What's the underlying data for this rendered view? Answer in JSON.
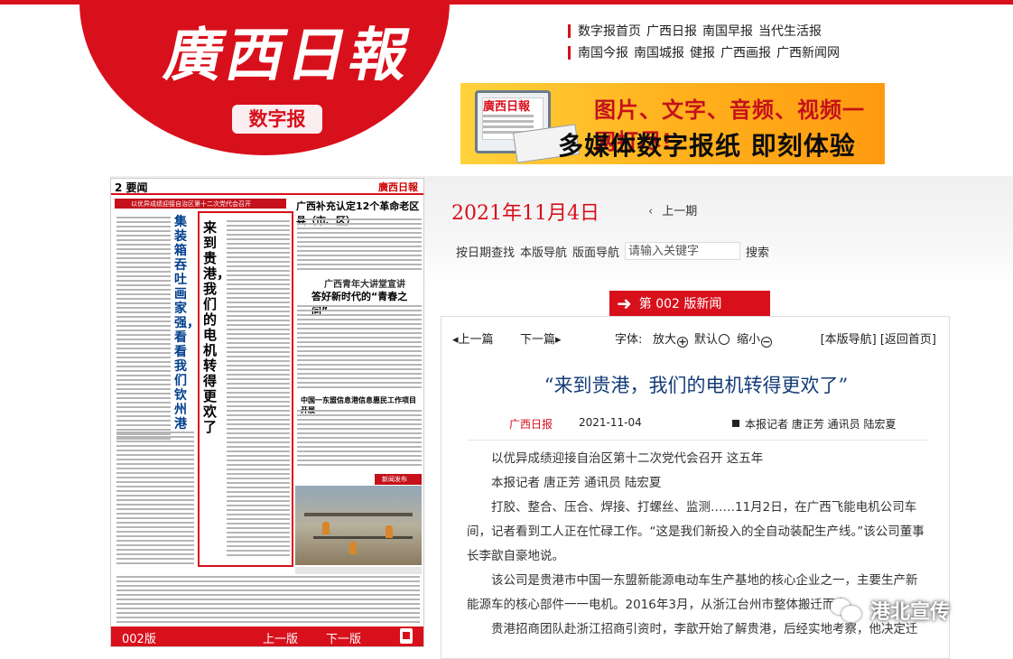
{
  "masthead": {
    "logo_text": "廣西日報",
    "logo_tag": "数字报",
    "links_row1": [
      "数字报首页",
      "广西日报",
      "南国早报",
      "当代生活报"
    ],
    "links_row2": [
      "南国今报",
      "南国城报",
      "健报",
      "广西画报",
      "广西新闻网"
    ]
  },
  "banner": {
    "logo_text": "廣西日報",
    "line1": "图片、文字、音频、视频一网打尽!",
    "line2": "多媒体数字报纸  即刻体验"
  },
  "issue": {
    "date": "2021年11月4日",
    "prev_issue": "上一期",
    "nav_by_date": "按日期查找",
    "nav_this_page": "本版导航",
    "nav_pages": "版面导航",
    "search_placeholder": "请输入关键字",
    "search_button": "搜索"
  },
  "page_tab": {
    "label": "第 002 版新闻"
  },
  "newspaper": {
    "page_num": "2 要闻",
    "masthead": "廣西日報",
    "strip_text": "以优异成绩迎接自治区第十二次党代会召开",
    "left_vertical_title": "集装箱吞吐画家强，看看我们钦州港",
    "highlight_vertical_title": "来到贵港，我们的电机转得更欢了",
    "right_title": "广西补充认定12个革命老区县（市、区）",
    "right_subtitle": "广西青年大讲堂宣讲",
    "right_subtitle2": "答好新时代的“青春之问”",
    "mid_title": "中国一东盟信息港信息惠民工作项目开展",
    "badge": "新闻发布",
    "bottom_version": "002版",
    "bottom_prev": "上一版",
    "bottom_next": "下一版"
  },
  "article": {
    "prev_label": "上一篇",
    "next_label": "下一篇",
    "font_label": "字体:",
    "font_bigger": "放大",
    "font_default": "默认",
    "font_smaller": "缩小",
    "right_links": "[本版导航] [返回首页]",
    "title": "“来到贵港，我们的电机转得更欢了”",
    "source": "广西日报",
    "date": "2021-11-04",
    "byline": "本报记者 唐正芳 通讯员 陆宏夏",
    "paragraphs": [
      "以优异成绩迎接自治区第十二次党代会召开 这五年",
      "本报记者 唐正芳 通讯员 陆宏夏",
      "打胶、整合、压合、焊接、打螺丝、监测……11月2日，在广西飞能电机公司车间，记者看到工人正在忙碌工作。“这是我们新投入的全自动装配生产线。”该公司董事长李歆自豪地说。",
      "该公司是贵港市中国一东盟新能源电动车生产基地的核心企业之一，主要生产新能源车的核心部件一一电机。2016年3月，从浙江台州市整体搬迁而来。",
      "贵港招商团队赴浙江招商引资时，李歆开始了解贵港，后经实地考察，他决定迁"
    ]
  },
  "watermark": {
    "text": "港北宣传"
  }
}
